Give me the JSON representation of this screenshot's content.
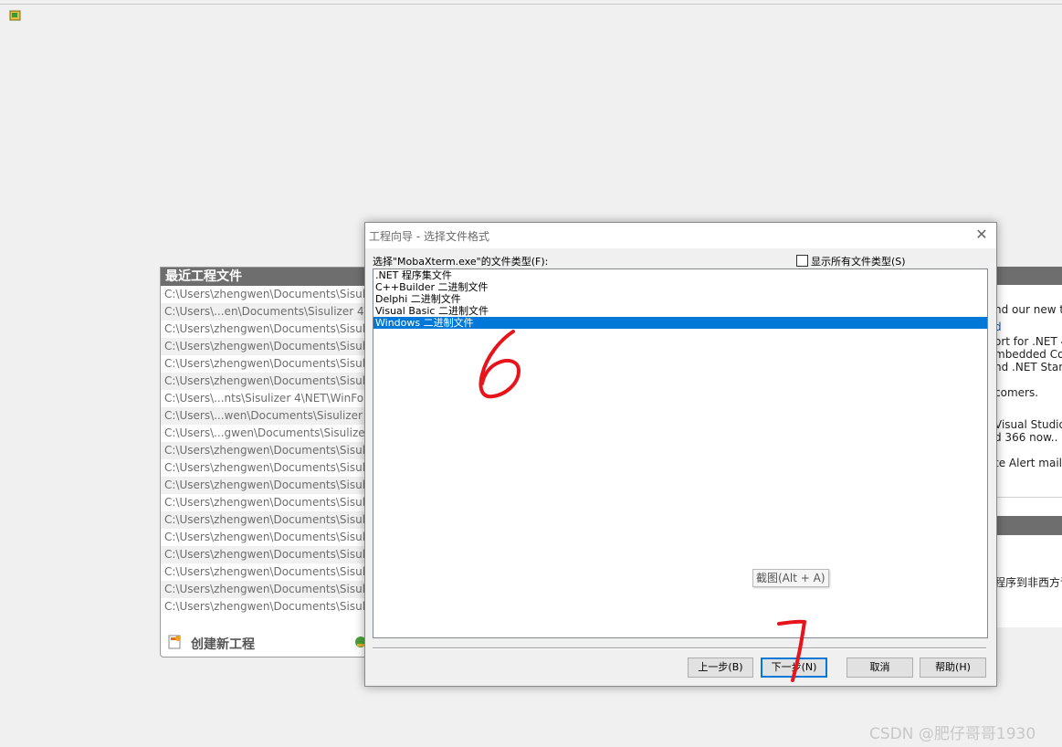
{
  "recent_projects": {
    "title": "最近工程文件",
    "items": [
      "C:\\Users\\zhengwen\\Documents\\Sisulizer",
      "C:\\Users\\...en\\Documents\\Sisulizer 4\\Da",
      "C:\\Users\\zhengwen\\Documents\\Sisulizer",
      "C:\\Users\\zhengwen\\Documents\\Sisulizer",
      "C:\\Users\\zhengwen\\Documents\\Sisulizer",
      "C:\\Users\\zhengwen\\Documents\\Sisulizer",
      "C:\\Users\\...nts\\Sisulizer 4\\NET\\WinForms",
      "C:\\Users\\...wen\\Documents\\Sisulizer 4\\M",
      "C:\\Users\\...gwen\\Documents\\Sisulizer 4\\",
      "C:\\Users\\zhengwen\\Documents\\Sisulizer",
      "C:\\Users\\zhengwen\\Documents\\Sisulizer",
      "C:\\Users\\zhengwen\\Documents\\Sisulizer",
      "C:\\Users\\zhengwen\\Documents\\Sisulizer",
      "C:\\Users\\zhengwen\\Documents\\Sisulizer",
      "C:\\Users\\zhengwen\\Documents\\Sisulizer",
      "C:\\Users\\zhengwen\\Documents\\Sisulizer",
      "C:\\Users\\zhengwen\\Documents\\Sisulizer",
      "C:\\Users\\zhengwen\\Documents\\Sisulizer",
      "C:\\Users\\zhengwen\\Documents\\Sisulizer"
    ],
    "new_project_label": "创建新工程"
  },
  "right_panel": {
    "lines": [
      "nd our new t",
      "d",
      "ort for .NET 4",
      "mbedded Com",
      "nd .NET Stan",
      "comers.",
      "Visual Studio 2",
      "d 366 now..",
      "te Alert mailin",
      "程序到非西方语"
    ]
  },
  "dialog": {
    "title": "工程向导 - 选择文件格式",
    "close_glyph": "✕",
    "prompt": "选择\"MobaXterm.exe\"的文件类型(F):",
    "show_all_label": "显示所有文件类型(S)",
    "file_types": [
      ".NET 程序集文件",
      "C++Builder 二进制文件",
      "Delphi 二进制文件",
      "Visual Basic 二进制文件",
      "Windows 二进制文件"
    ],
    "selected_index": 4,
    "buttons": {
      "back": "上一步(B)",
      "next": "下一步(N)",
      "cancel": "取消",
      "help": "帮助(H)"
    }
  },
  "tooltip": "截图(Alt + A)",
  "annotations": [
    "6",
    "7"
  ],
  "watermark": "CSDN @肥仔哥哥1930",
  "colors": {
    "selection": "#0078d7",
    "header_gray": "#6e6e6e",
    "annotation_red": "#e8141b"
  }
}
